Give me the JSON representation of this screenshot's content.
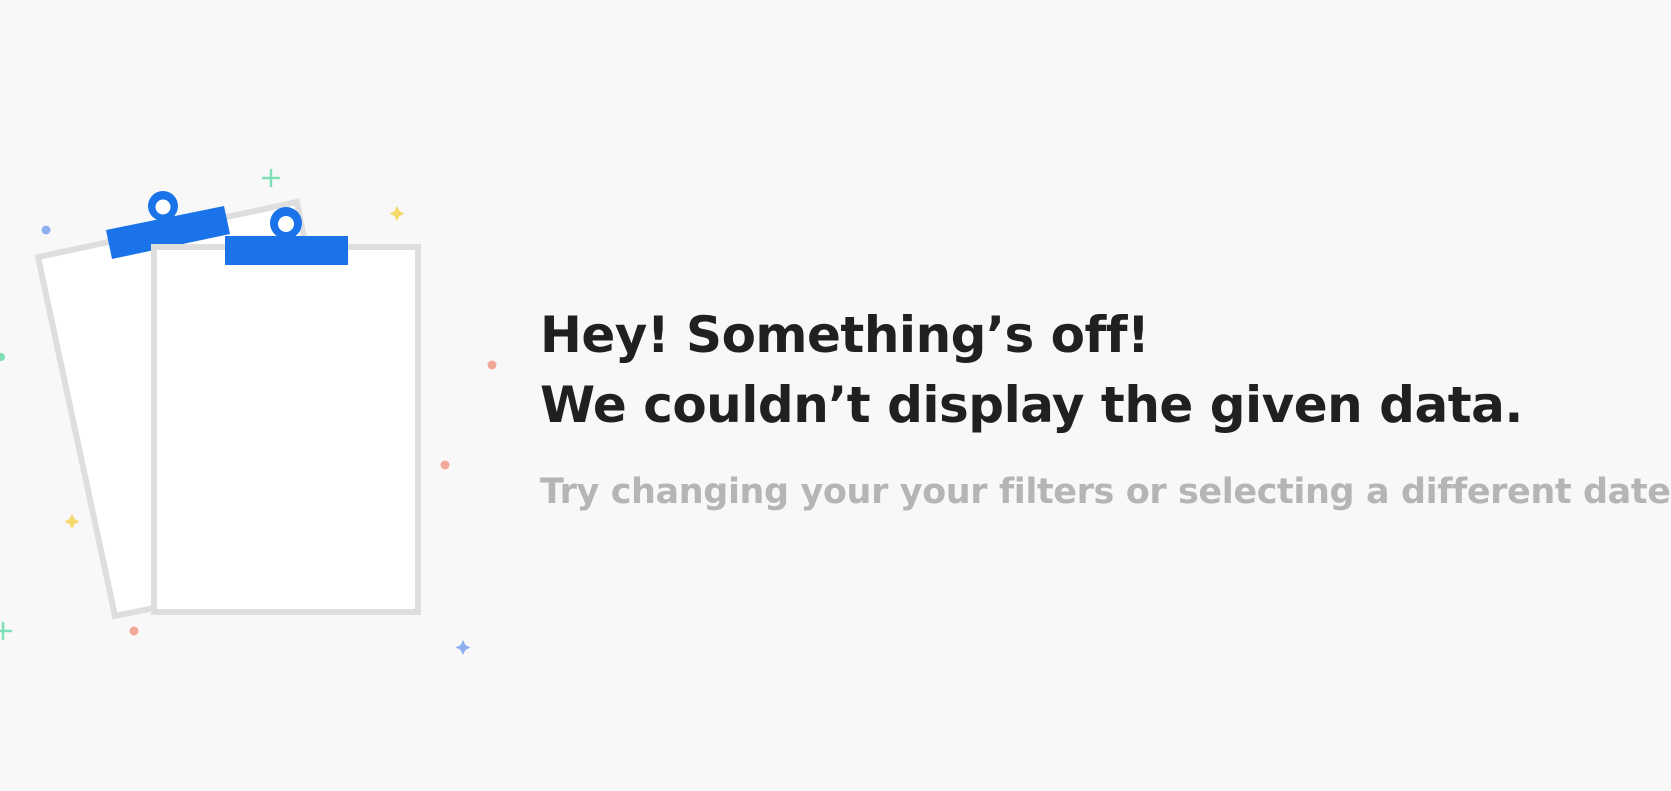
{
  "empty_state": {
    "headline_line1": "Hey! Something’s off!",
    "headline_line2": "We couldn’t display the given data.",
    "hint": "Try changing your your filters or selecting a different date."
  },
  "illustration": {
    "icon": "clipboard-icon",
    "accent_color": "#1a73e8",
    "sheet_color": "#ffffff",
    "border_color": "#dedede",
    "sparkle_colors": [
      "#7fe0b8",
      "#f6d86b",
      "#f2a898",
      "#8fb0ee"
    ]
  }
}
